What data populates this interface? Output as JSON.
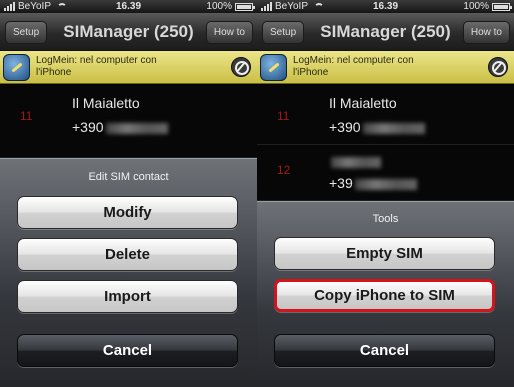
{
  "status": {
    "carrier": "BeYoIP",
    "time": "16.39",
    "battery": "100%"
  },
  "navbar": {
    "title": "SIManager (250)",
    "setup_label": "Setup",
    "howto_label": "How to"
  },
  "banner": {
    "text_line1": "LogMein: nel computer con",
    "text_line2": "l'iPhone"
  },
  "contacts": [
    {
      "number": "11",
      "name": "Il Maialetto",
      "phone": "+390"
    },
    {
      "number": "12",
      "phone": "+39"
    }
  ],
  "left_sheet": {
    "title": "Edit SIM contact",
    "buttons": [
      "Modify",
      "Delete",
      "Import"
    ],
    "cancel_label": "Cancel"
  },
  "right_sheet": {
    "title": "Tools",
    "buttons": [
      "Empty SIM",
      "Copy iPhone to SIM"
    ],
    "selected_button": "Copy iPhone to SIM",
    "cancel_label": "Cancel"
  },
  "colors": {
    "highlight": "#d3141b",
    "banner": "#e2d96a",
    "row_number": "#a01818"
  }
}
